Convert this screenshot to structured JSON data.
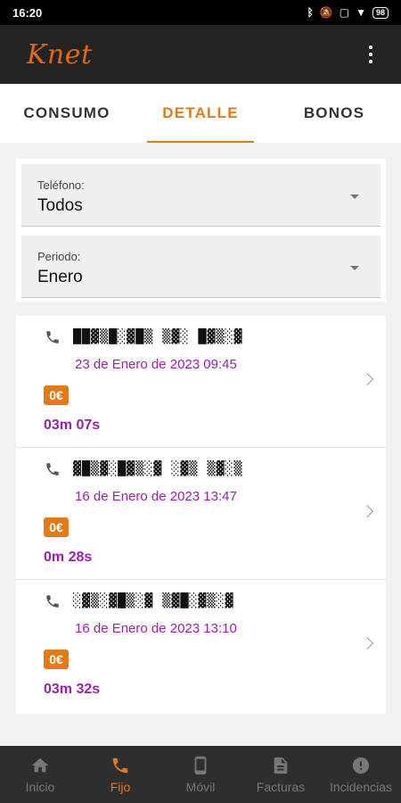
{
  "status_bar": {
    "time": "16:20",
    "battery": "98"
  },
  "app_bar": {
    "logo": "Knet",
    "menu_icon": "more-vert-icon"
  },
  "tabs": [
    {
      "label": "CONSUMO",
      "active": false
    },
    {
      "label": "DETALLE",
      "active": true
    },
    {
      "label": "BONOS",
      "active": false
    }
  ],
  "filters": {
    "telefono": {
      "label": "Teléfono:",
      "value": "Todos"
    },
    "periodo": {
      "label": "Periodo:",
      "value": "Enero"
    }
  },
  "calls": [
    {
      "number": "██▓▒█░▓█▒ ▒▓░ █▓▒░▓",
      "date": "23 de Enero de 2023 09:45",
      "price": "0€",
      "duration": "03m 07s"
    },
    {
      "number": "▓█▒▓░█▓▒░▓ ░▓▒ ▒▓░▒",
      "date": "16 de Enero de 2023 13:47",
      "price": "0€",
      "duration": "0m 28s"
    },
    {
      "number": "░▓▒░▓█▒░▓ ▒▓█░▓▒░▓",
      "date": "16 de Enero de 2023 13:10",
      "price": "0€",
      "duration": "03m 32s"
    }
  ],
  "bottom_nav": [
    {
      "label": "Inicio",
      "icon": "home-icon",
      "active": false
    },
    {
      "label": "Fijo",
      "icon": "phone-icon",
      "active": true
    },
    {
      "label": "Móvil",
      "icon": "mobile-icon",
      "active": false
    },
    {
      "label": "Facturas",
      "icon": "invoice-icon",
      "active": false
    },
    {
      "label": "Incidencias",
      "icon": "alert-icon",
      "active": false
    }
  ],
  "colors": {
    "accent": "#e07a1a",
    "purple": "#9a1fb0",
    "appbar": "#232323",
    "bottom_nav": "#2e2e2e"
  }
}
